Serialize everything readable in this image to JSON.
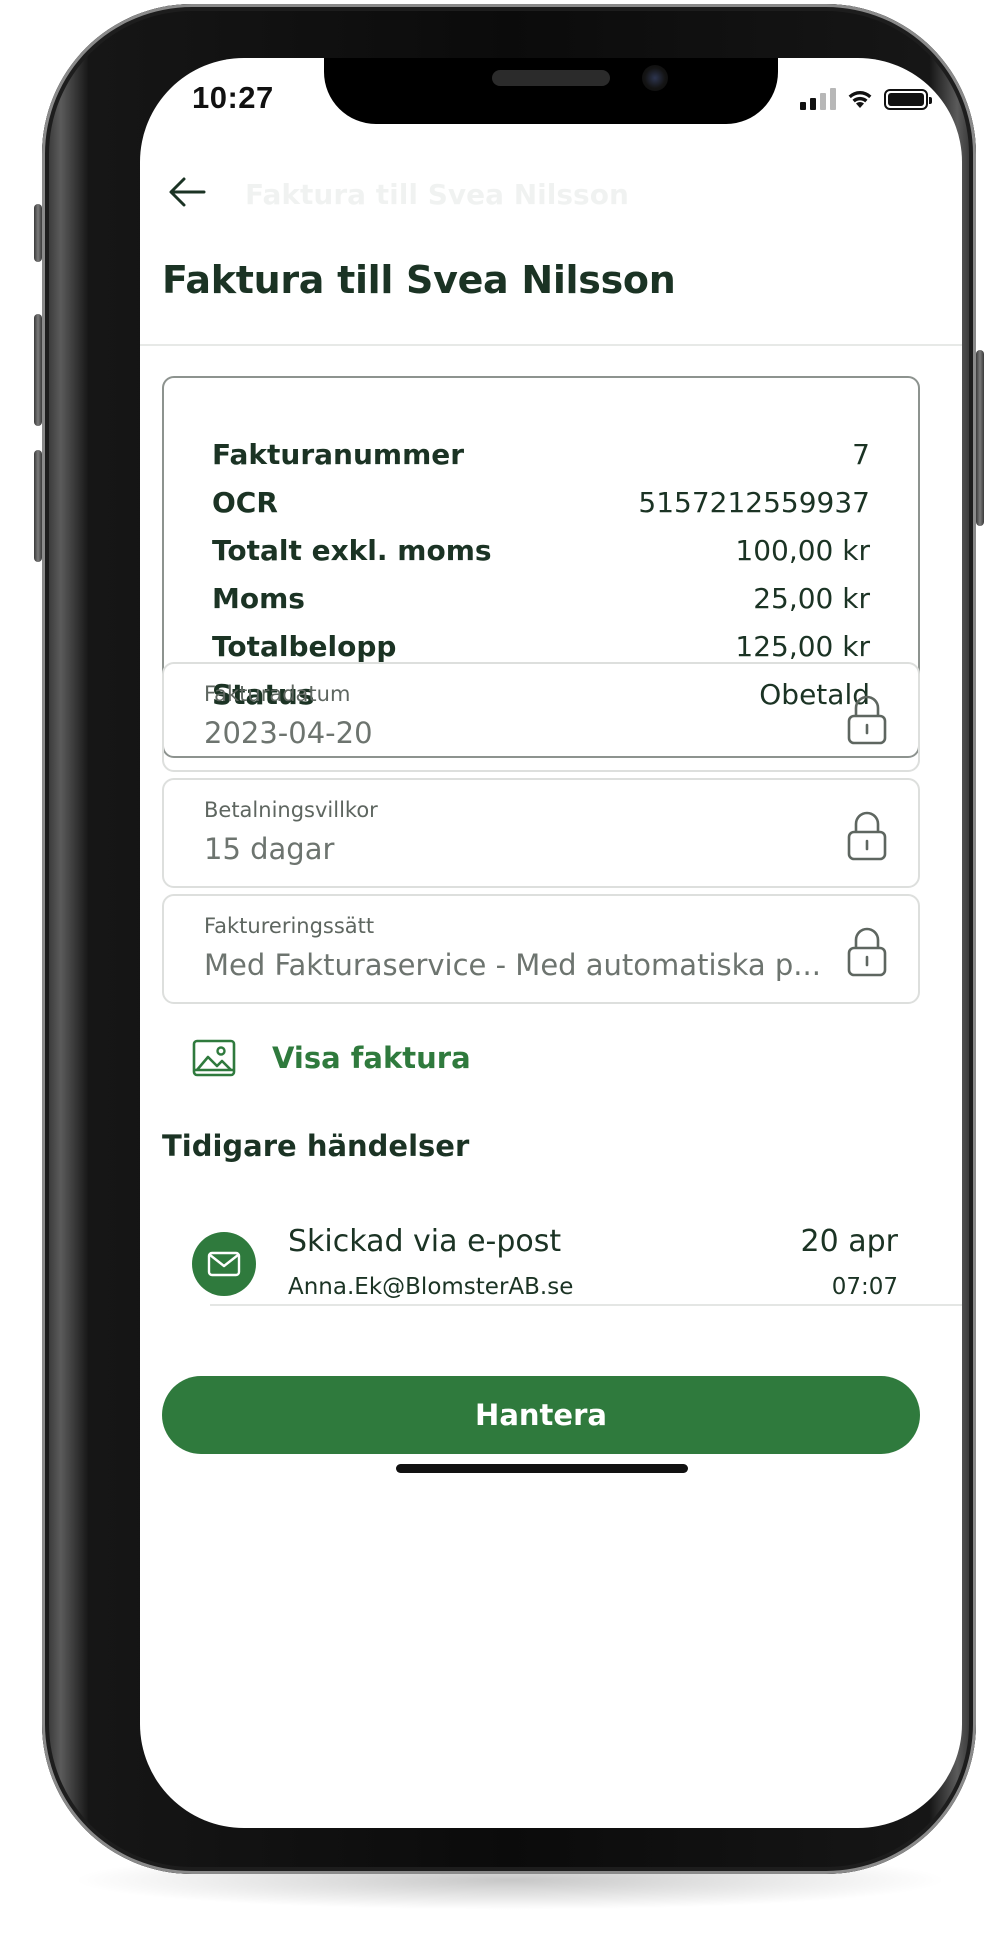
{
  "status_bar": {
    "time": "10:27"
  },
  "header": {
    "collapsed_title": "Faktura till Svea Nilsson",
    "title": "Faktura till Svea Nilsson"
  },
  "summary": {
    "rows": [
      {
        "key": "Fakturanummer",
        "value": "7"
      },
      {
        "key": "OCR",
        "value": "5157212559937"
      },
      {
        "key": "Totalt exkl. moms",
        "value": "100,00 kr"
      },
      {
        "key": "Moms",
        "value": "25,00 kr"
      },
      {
        "key": "Totalbelopp",
        "value": "125,00 kr"
      },
      {
        "key": "Status",
        "value": "Obetald"
      }
    ]
  },
  "fields": [
    {
      "label": "Fakturadatum",
      "value": "2023-04-20",
      "icon": "lock-icon"
    },
    {
      "label": "Betalningsvillkor",
      "value": "15 dagar",
      "icon": "lock-icon"
    },
    {
      "label": "Faktureringssätt",
      "value": "Med Fakturaservice - Med automatiska p...",
      "icon": "lock-icon"
    }
  ],
  "view_invoice": {
    "label": "Visa faktura",
    "icon": "image-icon"
  },
  "history": {
    "title": "Tidigare händelser",
    "events": [
      {
        "title": "Skickad via e-post",
        "subtitle": "Anna.Ek@BlomsterAB.se",
        "date": "20 apr",
        "time": "07:07",
        "icon": "mail-icon"
      }
    ]
  },
  "actions": {
    "primary_label": "Hantera"
  },
  "colors": {
    "brand_green": "#2f7a3d",
    "text_dark": "#1b3324",
    "muted": "#6d746f"
  }
}
